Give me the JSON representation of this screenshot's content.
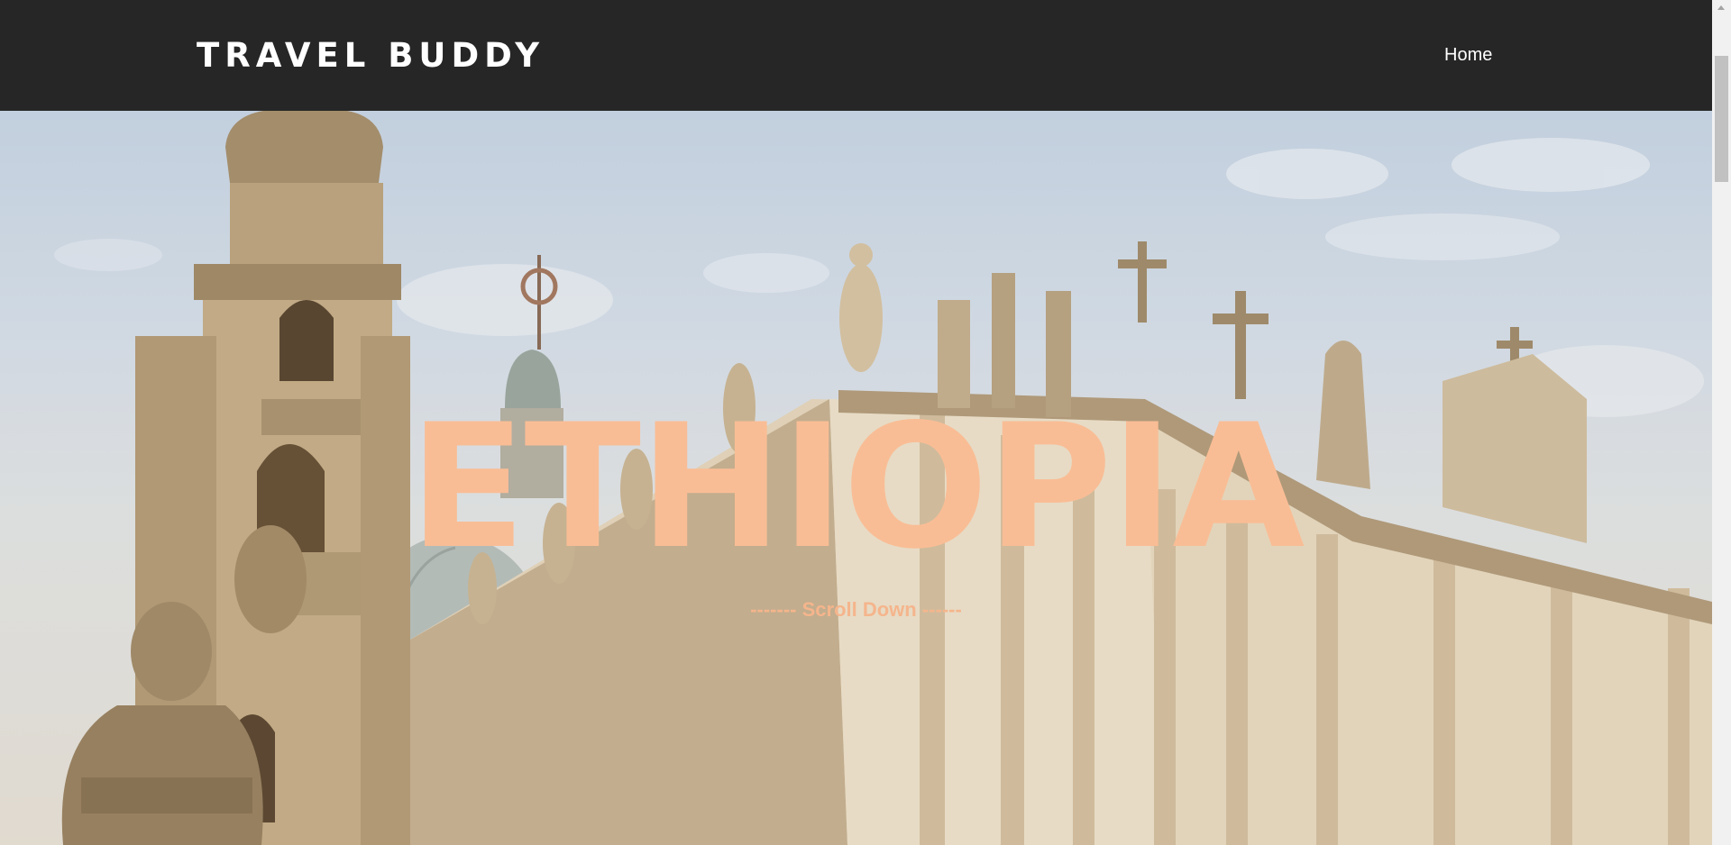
{
  "header": {
    "brand": "TRAVEL BUDDY",
    "nav": [
      {
        "label": "Home"
      }
    ]
  },
  "hero": {
    "title": "ETHIOPIA",
    "scroll_hint": "------- Scroll Down ------",
    "image_subject": "church-facade-photo"
  },
  "colors": {
    "navbar_bg": "#262626",
    "nav_text": "#ffffff",
    "hero_title": "#f9bd95",
    "scroll_hint": "#f5b58c"
  },
  "scrollbar": {
    "thumb_color": "#c1c1c1"
  }
}
